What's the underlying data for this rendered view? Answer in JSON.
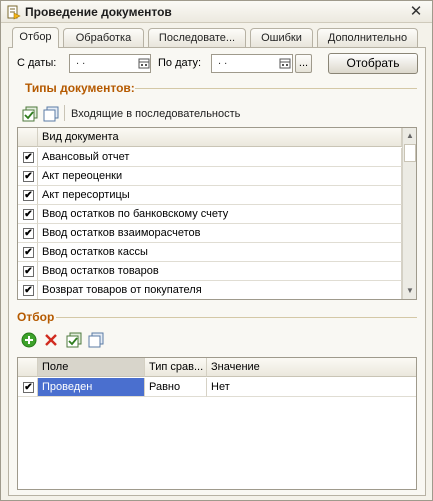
{
  "window": {
    "title": "Проведение документов",
    "close_glyph": "✕"
  },
  "tabs": [
    {
      "label": "Отбор",
      "active": true
    },
    {
      "label": "Обработка",
      "active": false
    },
    {
      "label": "Последовате...",
      "active": false
    },
    {
      "label": "Ошибки",
      "active": false
    },
    {
      "label": "Дополнительно",
      "active": false
    }
  ],
  "filter": {
    "from_label": "С даты:",
    "from_value": " .  .",
    "to_label": "По дату:",
    "to_value": " .  .",
    "ellipsis_button": "...",
    "select_button": "Отобрать"
  },
  "doc_types": {
    "section_title": "Типы документов:",
    "toolbar": {
      "include_sequence_label": "Входящие в последовательность"
    },
    "column_header": "Вид документа",
    "rows": [
      {
        "checked": true,
        "name": "Авансовый отчет"
      },
      {
        "checked": true,
        "name": "Акт переоценки"
      },
      {
        "checked": true,
        "name": "Акт пересортицы"
      },
      {
        "checked": true,
        "name": "Ввод остатков по банковскому счету"
      },
      {
        "checked": true,
        "name": "Ввод остатков взаиморасчетов"
      },
      {
        "checked": true,
        "name": "Ввод остатков кассы"
      },
      {
        "checked": true,
        "name": "Ввод остатков товаров"
      },
      {
        "checked": true,
        "name": "Возврат товаров от покупателя"
      }
    ]
  },
  "selection": {
    "section_title": "Отбор",
    "columns": [
      "Поле",
      "Тип срав...",
      "Значение"
    ],
    "rows": [
      {
        "checked": true,
        "field": "Проведен",
        "comparison": "Равно",
        "value": "Нет"
      }
    ]
  },
  "colors": {
    "section_title": "#b55a00",
    "selection_highlight": "#4a6fcf"
  },
  "icons": [
    "document-post-icon",
    "close-icon",
    "calendar-icon",
    "check-all-icon",
    "uncheck-all-icon",
    "add-icon",
    "delete-icon",
    "scroll-up-icon",
    "scroll-down-icon",
    "checkbox-icon"
  ]
}
